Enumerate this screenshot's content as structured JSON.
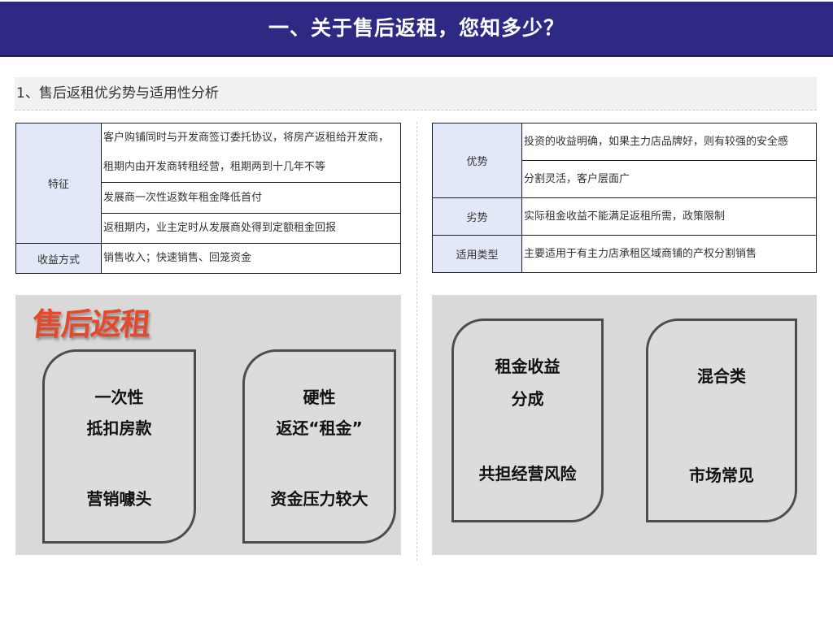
{
  "header": {
    "title": "一、关于售后返租，您知多少？"
  },
  "section": {
    "title": "1、售后返租优劣势与适用性分析"
  },
  "left_table": {
    "feature_label": "特征",
    "feature_row1": "客户购铺同时与开发商签订委托协议，将房产返租给开发商，租期内由开发商转租经营，租期两到十几年不等",
    "feature_row2": "发展商一次性返数年租金降低首付",
    "feature_row3": "返租期内，业主定时从发展商处得到定额租金回报",
    "income_label": "收益方式",
    "income_value": "销售收入；快速销售、回笼资金"
  },
  "right_table": {
    "adv_label": "优势",
    "adv_row1": "投资的收益明确，如果主力店品牌好，则有较强的安全感",
    "adv_row2": "分割灵活，客户层面广",
    "disadv_label": "劣势",
    "disadv_value": "实际租金收益不能满足返租所需，政策限制",
    "fit_label": "适用类型",
    "fit_value": "主要适用于有主力店承租区域商铺的产权分割销售"
  },
  "left_panel": {
    "logo_text": "售后返租",
    "card1": {
      "line1": "一次性",
      "line2": "抵扣房款",
      "line3": "营销噱头"
    },
    "card2": {
      "line1": "硬性",
      "line2": "返还“租金”",
      "line3": "资金压力较大"
    }
  },
  "right_panel": {
    "card3": {
      "line1": "租金收益",
      "line2": "分成",
      "line3": "共担经营风险"
    },
    "card4": {
      "line1": "混合类",
      "line2": "市场常见"
    }
  },
  "colors": {
    "banner": "#2e2a84",
    "label_cell": "#e2e8f8",
    "panel": "#d9d9d9",
    "logo": "#e24a2d"
  }
}
